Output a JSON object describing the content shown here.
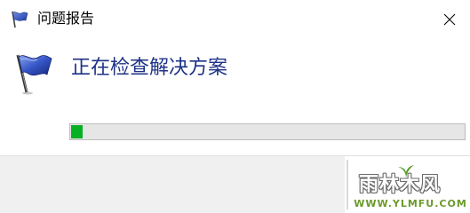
{
  "window": {
    "title": "问题报告"
  },
  "main": {
    "heading": "正在检查解决方案"
  },
  "progress": {
    "value_fraction": 0.03,
    "fill_color": "#06b025"
  },
  "icons": {
    "title_icon": "flag-icon",
    "main_icon": "flag-icon",
    "close": "close-icon"
  },
  "colors": {
    "heading": "#1e3287",
    "footer_bg": "#f0f0f0"
  },
  "watermark": {
    "brand_text": "雨林木风",
    "url_text": "WWW.YLMFU.COM"
  }
}
